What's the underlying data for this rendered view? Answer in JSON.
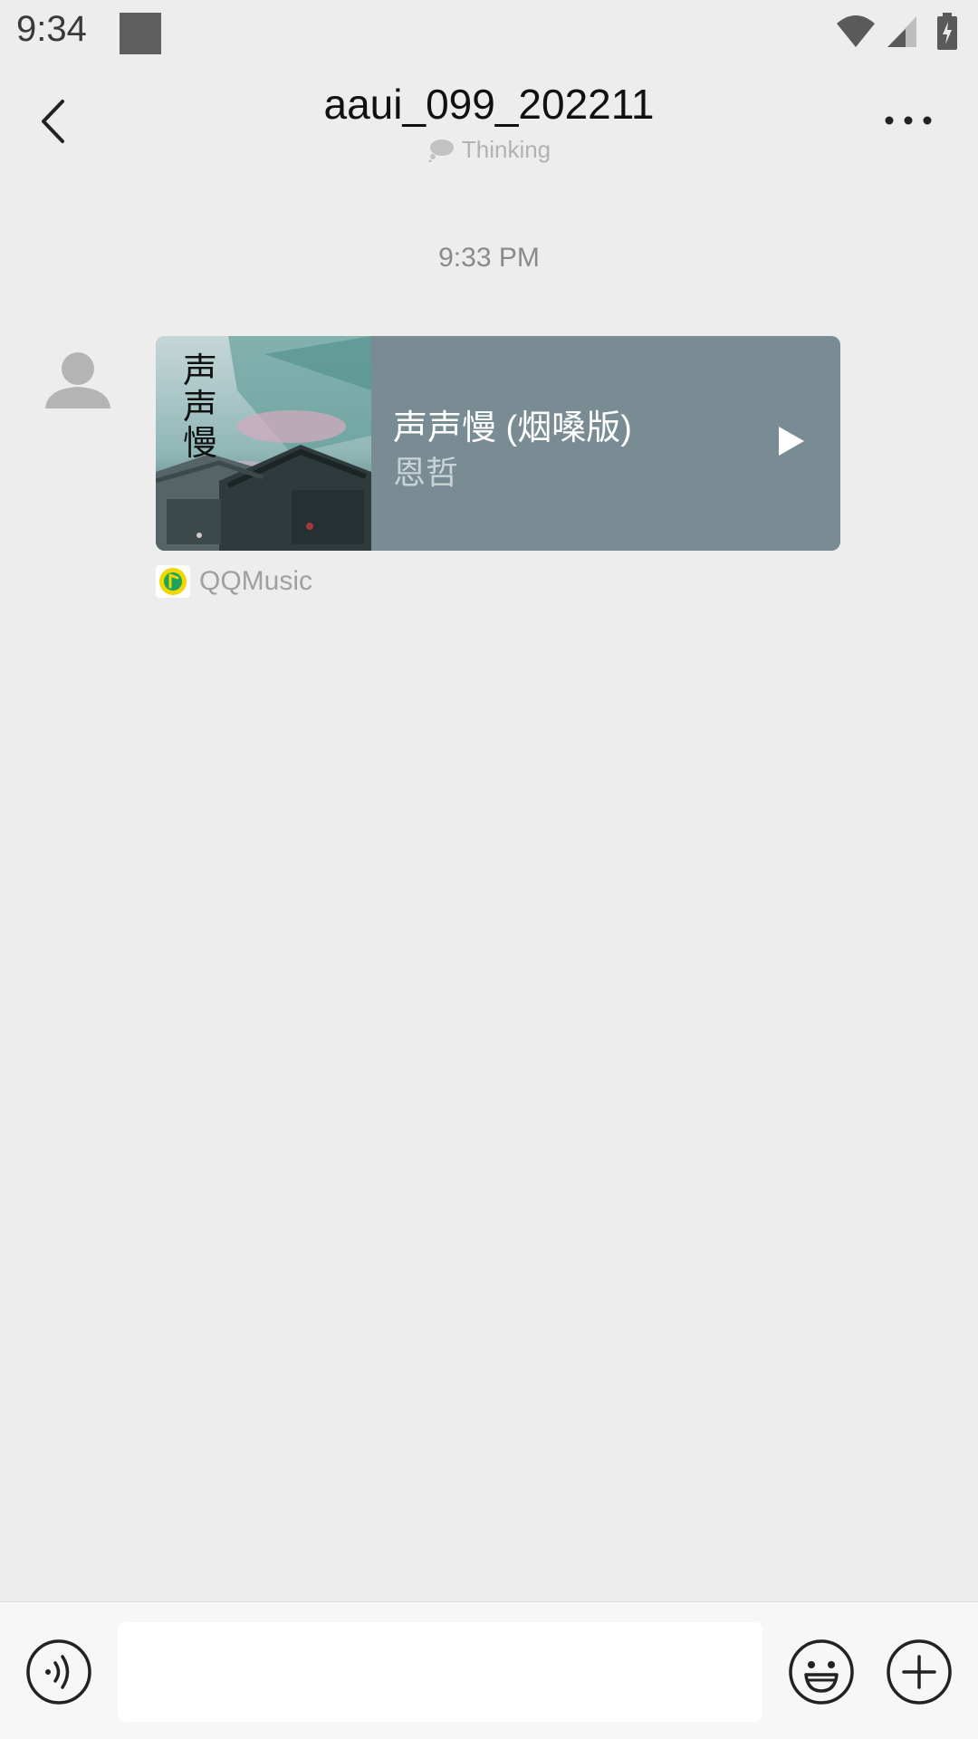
{
  "status_bar": {
    "time": "9:34"
  },
  "header": {
    "title": "aaui_099_202211",
    "subtitle": "Thinking",
    "icons": [
      "back-arrow-icon",
      "more-dots-icon",
      "speech-bubble-icon"
    ]
  },
  "chat": {
    "timestamp": "9:33 PM",
    "message": {
      "type": "music-card",
      "song_title": "声声慢 (烟嗓版)",
      "artist": "恩哲",
      "cover_text": "声声慢",
      "source": "QQMusic",
      "card_color": "#7a8c93"
    }
  },
  "input_bar": {
    "placeholder": "",
    "value": "",
    "icons": [
      "voice-icon",
      "emoji-icon",
      "plus-icon"
    ]
  }
}
